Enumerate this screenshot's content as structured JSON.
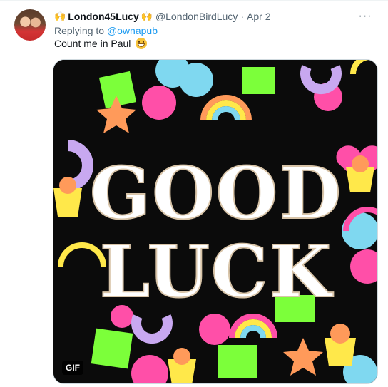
{
  "tweet": {
    "emoji_left": "🙌",
    "display_name": "London45Lucy",
    "emoji_right": "🙌",
    "handle": "@LondonBirdLucy",
    "separator": "·",
    "date": "Apr 2",
    "more": "···",
    "reply_prefix": "Replying to",
    "reply_target": "@ownapub",
    "text": "Count me in Paul",
    "text_emoji": "grinning-face"
  },
  "media": {
    "line1": "GOOD",
    "line2": "LUCK",
    "badge": "GIF"
  },
  "colors": {
    "link": "#1d9bf0",
    "muted": "#536471",
    "gif_bg": "#0b0b0b",
    "charm_pink": "#ff4fa8",
    "charm_green": "#7cff3a",
    "charm_blue": "#7fd8f0",
    "charm_purple": "#c8a8f0",
    "charm_orange": "#ff9a5a",
    "charm_yellow": "#ffe84a"
  }
}
